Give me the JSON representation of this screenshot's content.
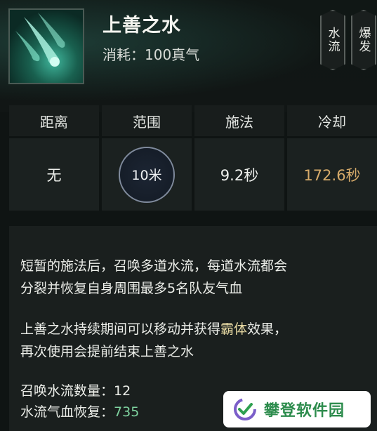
{
  "skill": {
    "name": "上善之水",
    "cost": "消耗：100真气"
  },
  "tags": [
    "水流",
    "爆发"
  ],
  "stats": [
    {
      "label": "距离",
      "value": "无"
    },
    {
      "label": "范围",
      "value": "10米"
    },
    {
      "label": "施法",
      "value": "9.2秒"
    },
    {
      "label": "冷却",
      "value": "172.6秒"
    }
  ],
  "description": {
    "p1_line1": "短暂的施法后，召唤多道水流，每道水流都会",
    "p1_line2": "分裂并恢复自身周围最多5名队友气血",
    "p2_line1_a": "上善之水持续期间可以移动并获得",
    "p2_line1_hl": "霸体",
    "p2_line1_b": "效果，",
    "p2_line2": "再次使用会提前结束上善之水",
    "attr1_label": "召唤水流数量：",
    "attr1_value": "12",
    "attr2_label": "水流气血恢复：",
    "attr2_value": "735"
  },
  "watermark": {
    "text": "攀登软件园"
  },
  "colors": {
    "cooldown": "#d7ab6a",
    "heal_value": "#7fd3a0",
    "watermark": "#2d8c4d"
  }
}
